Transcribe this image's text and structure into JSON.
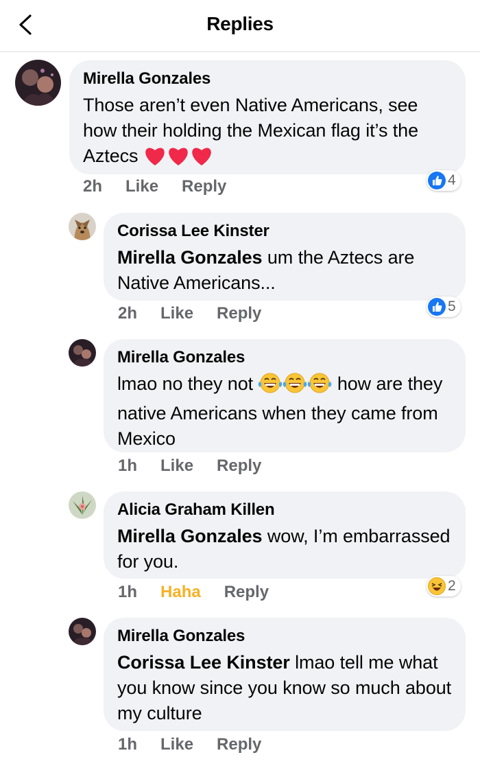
{
  "header": {
    "title": "Replies",
    "back_icon": "chevron-left-icon"
  },
  "comments": [
    {
      "author": "Mirella Gonzales",
      "text": "Those aren’t even Native Americans, see how their holding the Mexican flag it’s the Aztecs",
      "emojis": "heart-icon x3",
      "time": "2h",
      "like": "Like",
      "reply": "Reply",
      "reaction": {
        "icon": "like-icon",
        "count": "4"
      }
    },
    {
      "author": "Corissa Lee Kinster",
      "mention": "Mirella Gonzales",
      "text": " um the Aztecs are Native Americans...",
      "time": "2h",
      "like": "Like",
      "reply": "Reply",
      "reaction": {
        "icon": "like-icon",
        "count": "5"
      }
    },
    {
      "author": "Mirella Gonzales",
      "text_before": "lmao no they not ",
      "emojis": "laughing-tears-icon x3",
      "text_after": " how are they native Americans when they came from Mexico",
      "time": "1h",
      "like": "Like",
      "reply": "Reply"
    },
    {
      "author": "Alicia Graham Killen",
      "mention": "Mirella Gonzales",
      "text": " wow, I’m embarrassed for you.",
      "time": "1h",
      "like": "Haha",
      "reply": "Reply",
      "reaction": {
        "icon": "haha-icon",
        "count": "2"
      }
    },
    {
      "author": "Mirella Gonzales",
      "mention": "Corissa Lee Kinster",
      "text": " lmao tell me what you know since you know so much about my culture",
      "time": "1h",
      "like": "Like",
      "reply": "Reply"
    }
  ],
  "colors": {
    "bubble": "#f0f2f5",
    "meta": "#65676b",
    "haha": "#f7b125",
    "like_blue": "#1877f2",
    "heart": "#f0284a"
  }
}
